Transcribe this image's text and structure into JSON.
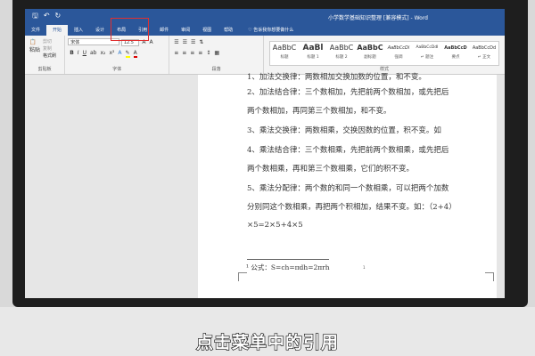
{
  "window": {
    "title": "小学数学基础知识整理 [兼容模式] - Word"
  },
  "tabs": [
    "文件",
    "开始",
    "插入",
    "设计",
    "布局",
    "引用",
    "邮件",
    "审阅",
    "视图",
    "帮助"
  ],
  "tell_me": "告诉我你想要做什么",
  "clipboard": {
    "paste": "粘贴",
    "cut": "剪切",
    "copy": "复制",
    "format_painter": "格式刷",
    "label": "剪贴板"
  },
  "font": {
    "name": "宋体",
    "size": "12.5",
    "label": "字体"
  },
  "paragraph": {
    "label": "段落"
  },
  "styles": {
    "label": "样式",
    "items": [
      {
        "preview": "AaBbC",
        "name": "标题"
      },
      {
        "preview": "AaBl",
        "name": "标题 1"
      },
      {
        "preview": "AaBbC",
        "name": "标题 2"
      },
      {
        "preview": "AaBbC",
        "name": "副标题"
      },
      {
        "preview": "AaBbCcDi",
        "name": "强调"
      },
      {
        "preview": "AaBbCcDdI",
        "name": "↵ 题注"
      },
      {
        "preview": "AaBbCcD",
        "name": "要点"
      },
      {
        "preview": "AaBbCcDd",
        "name": "↵ 正文"
      }
    ]
  },
  "document": {
    "lines": [
      "1、加法交换律：两数相加交换加数的位置，和不变。",
      "2、加法结合律：三个数相加，先把前两个数相加，或先把后",
      "两个数相加，再同第三个数相加，和不变。",
      "3、乘法交换律：两数相乘，交换因数的位置，积不变。如",
      "4、乘法结合律：三个数相乘，先把前两个数相乘，或先把后",
      "两个数相乘，再和第三个数相乘，它们的积不变。",
      "5、乘法分配律：两个数的和同一个数相乘，可以把两个加数",
      "分别同这个数相乘，再把两个积相加，结果不变。如：（2+4）",
      "×5=2×5+4×5"
    ],
    "footnote": "¹ 公式：S=ch=πdh=2πrh",
    "page_number": "1"
  },
  "caption": "点击菜单中的引用"
}
